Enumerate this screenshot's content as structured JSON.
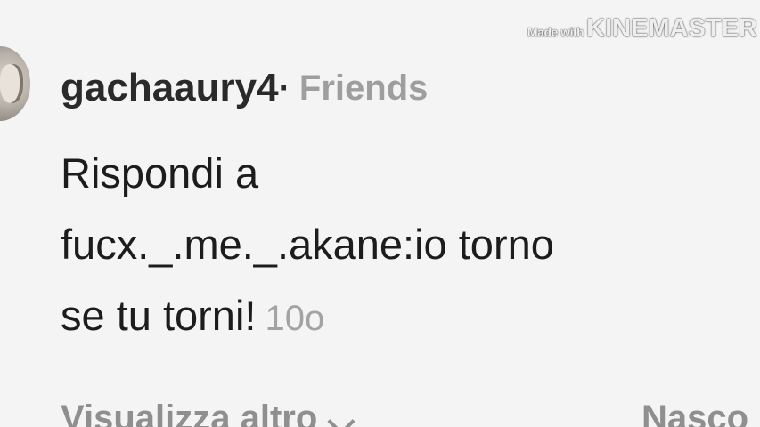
{
  "watermark": {
    "small": "Made with",
    "big": "KINEMASTER"
  },
  "comment": {
    "username": "gachaaury4",
    "separator": "·",
    "relation": "Friends",
    "lines": [
      "Rispondi a",
      "fucx._.me._.akane:io torno",
      "se tu torni!"
    ],
    "time": "10o",
    "avatar_icon": "profile-avatar"
  },
  "footer": {
    "view_more": "Visualizza altro",
    "view_more_icon": "chevron-down-icon",
    "hide": "Nasco"
  }
}
